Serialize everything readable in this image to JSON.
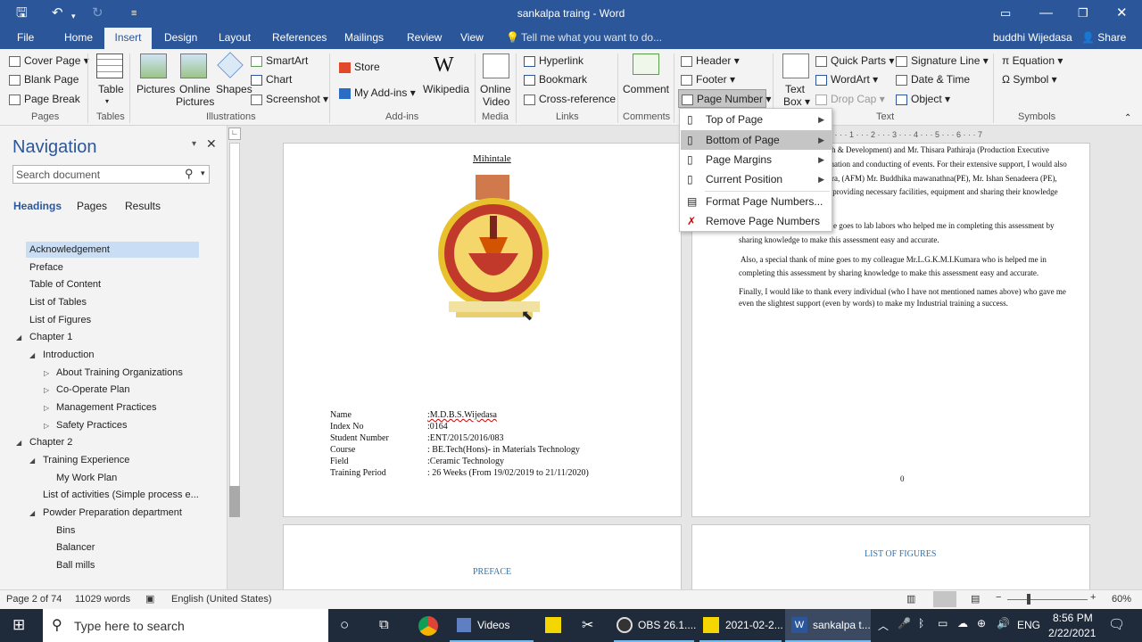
{
  "window": {
    "title": "sankalpa traing - Word"
  },
  "tabs": [
    "File",
    "Home",
    "Insert",
    "Design",
    "Layout",
    "References",
    "Mailings",
    "Review",
    "View"
  ],
  "tell_me": "Tell me what you want to do...",
  "user": "buddhi Wijedasa",
  "share": "Share",
  "ribbon": {
    "pages": {
      "items": [
        "Cover Page",
        "Blank Page",
        "Page Break"
      ],
      "label": "Pages"
    },
    "tables": {
      "item": "Table",
      "label": "Tables"
    },
    "illustrations": {
      "pictures": "Pictures",
      "online_pictures_1": "Online",
      "online_pictures_2": "Pictures",
      "shapes": "Shapes",
      "smartart": "SmartArt",
      "chart": "Chart",
      "screenshot": "Screenshot",
      "label": "Illustrations"
    },
    "addins": {
      "store": "Store",
      "my_addins": "My Add-ins",
      "wikipedia": "Wikipedia",
      "label": "Add-ins"
    },
    "media": {
      "online_video_1": "Online",
      "online_video_2": "Video",
      "label": "Media"
    },
    "links": {
      "hyperlink": "Hyperlink",
      "bookmark": "Bookmark",
      "cross_reference": "Cross-reference",
      "label": "Links"
    },
    "comments": {
      "comment": "Comment",
      "label": "Comments"
    },
    "header_footer": {
      "header": "Header",
      "footer": "Footer",
      "page_number": "Page Number"
    },
    "text": {
      "text_box_1": "Text",
      "text_box_2": "Box",
      "quick_parts": "Quick Parts",
      "wordart": "WordArt",
      "drop_cap": "Drop Cap",
      "signature_line": "Signature Line",
      "date_time": "Date & Time",
      "object": "Object",
      "label": "Text"
    },
    "symbols": {
      "equation": "Equation",
      "symbol": "Symbol",
      "label": "Symbols"
    }
  },
  "page_number_menu": [
    "Top of Page",
    "Bottom of Page",
    "Page Margins",
    "Current Position",
    "Format Page Numbers...",
    "Remove Page Numbers"
  ],
  "navigation": {
    "title": "Navigation",
    "search_placeholder": "Search document",
    "tabs": [
      "Headings",
      "Pages",
      "Results"
    ],
    "items": [
      "Acknowledgement",
      "Preface",
      "Table of Content",
      "List of Tables",
      "List of Figures",
      "Chapter 1",
      "Introduction",
      "About Training Organizations",
      "Co-Operate Plan",
      "Management Practices",
      "Safety Practices",
      "Chapter 2",
      "Training Experience",
      "My Work Plan",
      "List of activities (Simple process e...",
      "Powder Preparation department",
      "Bins",
      "Balancer",
      "Ball mills"
    ]
  },
  "doc": {
    "mihintale": "Mihintale",
    "info_labels": [
      "Name",
      "Index No",
      "Student Number",
      "Course",
      "Field",
      "Training Period"
    ],
    "info_values": [
      ":M.D.B.S.Wijedasa",
      ":0164",
      ":ENT/2015/2016/083",
      ": BE.Tech(Hons)- in Materials Technology",
      ":Ceramic Technology",
      ": 26 Weeks (From 19/02/2019 to 21/11/2020)"
    ],
    "right_lines": [
      "ch & Development) and Mr. Thisara Pathiraja (Production Executive",
      "ination and conducting of events. For their extensive support, I would also",
      "era, (AFM) Mr. Buddhika mawanathna(PE), Mr. Ishan Senadeera (PE),",
      "r providing necessary facilities, equipment and sharing their knowledge",
      "e goes to lab labors who helped me in completing this assessment by",
      "sharing knowledge to make this assessment easy and accurate.",
      "Also, a special thank of mine goes to my colleague Mr.L.G.K.M.I.Kumara who is helped me in",
      "completing this assessment by sharing knowledge to make this assessment easy and accurate.",
      "Finally, I would like to thank every individual (who I have not mentioned names above) who gave me",
      "even the slightest support (even by words) to make my Industrial training a success."
    ],
    "page_num": "0",
    "preface": "PREFACE",
    "list_of_figures": "LIST OF FIGURES",
    "ruler_right": "2 · · · 1 · · · 2 · · · 3 · · · 4 · · · 5 · · · 6 · · · 7"
  },
  "status": {
    "page": "Page 2 of 74",
    "words": "11029 words",
    "lang": "English (United States)",
    "zoom": "60%"
  },
  "taskbar": {
    "search": "Type here to search",
    "videos": "Videos",
    "obs": "OBS 26.1....",
    "file": "2021-02-2...",
    "word": "sankalpa t...",
    "lang": "ENG",
    "time": "8:56 PM",
    "date": "2/22/2021"
  }
}
